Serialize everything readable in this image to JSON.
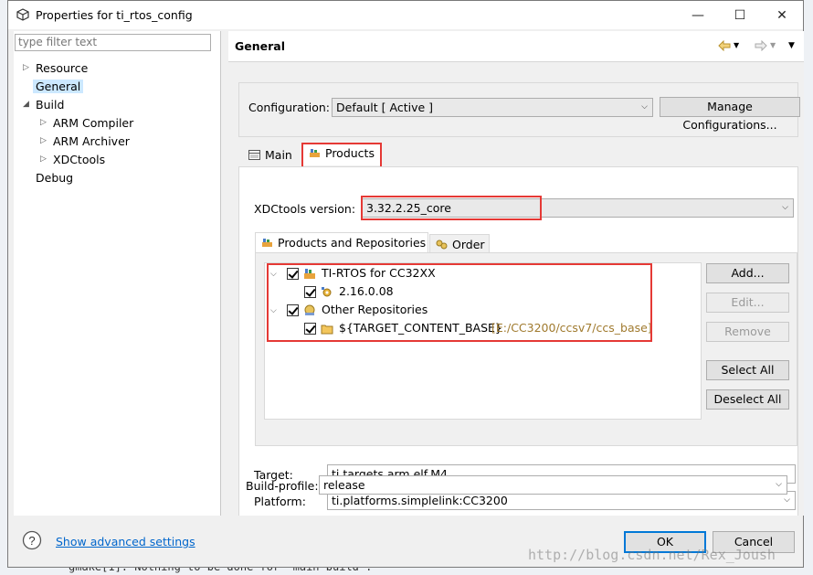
{
  "window": {
    "title": "Properties for ti_rtos_config",
    "controls": {
      "minimize": "—",
      "maximize": "☐",
      "close": "✕"
    }
  },
  "sidebar": {
    "filter_placeholder": "type filter text",
    "items": [
      {
        "label": "Resource"
      },
      {
        "label": "General"
      },
      {
        "label": "Build"
      },
      {
        "label": "ARM Compiler"
      },
      {
        "label": "ARM Archiver"
      },
      {
        "label": "XDCtools"
      },
      {
        "label": "Debug"
      }
    ]
  },
  "page": {
    "title": "General",
    "configuration_label": "Configuration:",
    "configuration_value": "Default  [ Active ]",
    "manage_button": "Manage Configurations...",
    "tabs": [
      {
        "label": "Main"
      },
      {
        "label": "Products"
      }
    ],
    "xdctools_label": "XDCtools version:",
    "xdctools_value": "3.32.2.25_core",
    "subtabs": [
      {
        "label": "Products and Repositories"
      },
      {
        "label": "Order"
      }
    ],
    "tree": [
      {
        "label": "TI-RTOS for CC32XX",
        "path": ""
      },
      {
        "label": "2.16.0.08",
        "path": ""
      },
      {
        "label": "Other Repositories",
        "path": ""
      },
      {
        "label": "${TARGET_CONTENT_BASE}",
        "path": "[E:/CC3200/ccsv7/ccs_base]"
      }
    ],
    "side_buttons": {
      "add": "Add...",
      "edit": "Edit...",
      "remove": "Remove",
      "select_all": "Select All",
      "deselect_all": "Deselect All"
    },
    "target_label": "Target:",
    "target_value": "ti.targets.arm.elf.M4",
    "platform_label": "Platform:",
    "platform_value": "ti.platforms.simplelink:CC3200",
    "buildprofile_label": "Build-profile:",
    "buildprofile_value": "release"
  },
  "footer": {
    "advanced_link": "Show advanced settings",
    "ok": "OK",
    "cancel": "Cancel"
  },
  "watermark": "http://blog.csdn.net/Rex_Joush",
  "background_text": "gmake[1]: Nothing to be done for 'main-build'.",
  "colors": {
    "highlight": "#e53935",
    "selection": "#cce8ff",
    "link": "#0066cc",
    "path": "#a07a2e"
  }
}
